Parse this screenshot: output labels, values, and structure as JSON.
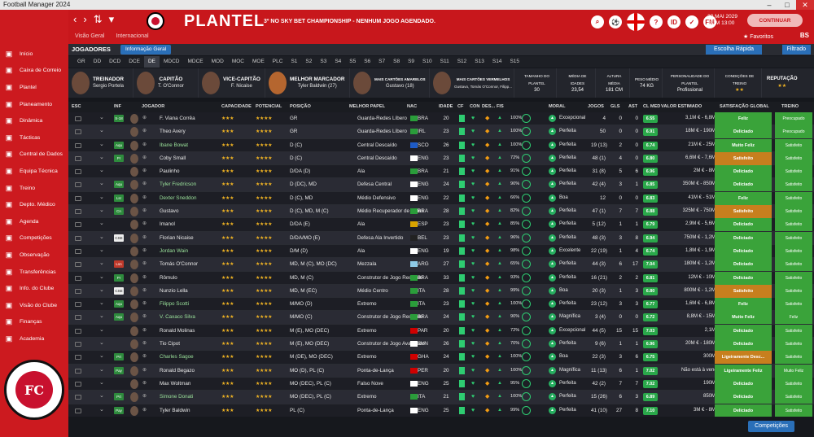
{
  "window": {
    "title": "Football Manager 2024"
  },
  "sidebar": {
    "items": [
      {
        "label": "Início",
        "icon": "home-icon"
      },
      {
        "label": "Caixa de Correio",
        "icon": "mail-icon"
      },
      {
        "label": "Plantel",
        "icon": "squad-icon"
      },
      {
        "label": "Planeamento",
        "icon": "planning-icon"
      },
      {
        "label": "Dinâmica",
        "icon": "dynamics-icon"
      },
      {
        "label": "Tácticas",
        "icon": "tactics-icon"
      },
      {
        "label": "Central de Dados",
        "icon": "data-icon"
      },
      {
        "label": "Equipa Técnica",
        "icon": "staff-icon"
      },
      {
        "label": "Treino",
        "icon": "training-icon"
      },
      {
        "label": "Depto. Médico",
        "icon": "medical-icon"
      },
      {
        "label": "Agenda",
        "icon": "calendar-icon"
      },
      {
        "label": "Competições",
        "icon": "trophy-icon"
      },
      {
        "label": "Observação",
        "icon": "scouting-icon"
      },
      {
        "label": "Transferências",
        "icon": "transfer-icon"
      },
      {
        "label": "Info. do Clube",
        "icon": "club-icon"
      },
      {
        "label": "Visão do Clube",
        "icon": "vision-icon"
      },
      {
        "label": "Finanças",
        "icon": "finance-icon"
      },
      {
        "label": "Academia",
        "icon": "academy-icon"
      }
    ],
    "crest_text": "FOOTBALL CLUB UNITED OF MANCHESTER",
    "crest_initials": "FC"
  },
  "header": {
    "title": "PLANTEL",
    "subtitle": "3º NO SKY BET CHAMPIONSHIP - NENHUM JOGO AGENDADO.",
    "subnav": [
      "Visão Geral",
      "Internacional"
    ],
    "date_line1": "30 MAI 2029",
    "date_line2": "DOM 13:00",
    "continue_label": "CONTINUAR",
    "favorites_label": "★ Favoritos",
    "bs_label": "BS",
    "nav_back": "‹",
    "nav_forward": "›"
  },
  "toolbar": {
    "section_label": "JOGADORES",
    "view_label": "Informação Geral",
    "quick_label": "Escolha Rápida",
    "filter_label": "Filtrado"
  },
  "tabs": [
    "GR",
    "DD",
    "DCD",
    "DCE",
    "DE",
    "MDCD",
    "MDCE",
    "MOD",
    "MOC",
    "MOE",
    "PLC",
    "S1",
    "S2",
    "S3",
    "S4",
    "S5",
    "S6",
    "S7",
    "S8",
    "S9",
    "S10",
    "S11",
    "S12",
    "S13",
    "S14",
    "S15"
  ],
  "staff": {
    "trainer": {
      "role": "TREINADOR",
      "name": "Sergio Portela"
    },
    "captain": {
      "role": "CAPITÃO",
      "name": "T. O'Connor"
    },
    "vice": {
      "role": "VICE-CAPITÃO",
      "name": "F. Nicaise"
    },
    "scorer": {
      "role": "MELHOR MARCADOR",
      "name": "Tyler Baldwin (27)"
    },
    "yellow": {
      "role": "MAIS CARTÕES AMARELOS",
      "name": "Gustavo (18)"
    },
    "red": {
      "role": "MAIS CARTÕES VERMELHOS",
      "name": "Gustavo, Tomás O'Connor, Filipp..."
    },
    "squad_size": {
      "label": "TAMANHO DO PLANTEL",
      "value": "30"
    },
    "avg_age": {
      "label": "MÉDIA DE IDADES",
      "value": "23,54"
    },
    "avg_height": {
      "label": "ALTURA MÉDIA",
      "value": "181 CM"
    },
    "avg_weight": {
      "label": "PESO MÉDIO",
      "value": "74 KG"
    },
    "personality": {
      "label": "PERSONALIDADE DO PLANTEL",
      "value": "Profissional"
    },
    "training": {
      "label": "CONDIÇÕES DE TREINO",
      "stars": "★★"
    },
    "reputation": {
      "label": "REPUTAÇÃO",
      "stars": "★★"
    }
  },
  "columns": {
    "esc": "ESC",
    "inf": "INF",
    "player": "JOGADOR",
    "capacity": "CAPACIDADE",
    "potential": "POTENCIAL",
    "position": "POSIÇÃO",
    "role": "MELHOR PAPEL",
    "nat": "NAC",
    "age": "IDADE",
    "cf": "CF",
    "con": "CON",
    "des": "DES...",
    "fis": "FIS",
    "morale": "MORAL",
    "games": "JOGOS",
    "goals": "GLS",
    "assists": "AST",
    "rating": "CL MED",
    "value": "VALOR ESTIMADO",
    "satisfaction": "SATISFAÇÃO GLOBAL",
    "training": "TREINO"
  },
  "players": [
    {
      "badge": "S-18",
      "name": "F. Viana Corrêa",
      "cap": "★★★",
      "pot": "★★★★",
      "pos": "GR",
      "role": "Guarda-Redes Líbero",
      "nat": "BRA",
      "age": "20",
      "pct": "100%",
      "moral": "Excepcional",
      "jog": "4",
      "gls": "0",
      "ast": "0",
      "cm": "6.55",
      "val": "3,1M € - 6,8M €",
      "sat": "Feliz",
      "tre": "Preocupado"
    },
    {
      "badge": "",
      "name": "Theo Avery",
      "cap": "★★★",
      "pot": "★★★★",
      "pos": "GR",
      "role": "Guarda-Redes Líbero",
      "nat": "IRL",
      "age": "23",
      "pct": "100%",
      "moral": "Perfeita",
      "jog": "50",
      "gls": "0",
      "ast": "0",
      "cm": "6.91",
      "val": "18M € - 190M €",
      "sat": "Deliciado",
      "tre": "Preocupado"
    },
    {
      "badge": "Aqu",
      "name": "Ibane Bowat",
      "cap": "★★★",
      "pot": "★★★★",
      "pos": "D (C)",
      "role": "Central Descaído",
      "nat": "SCO",
      "age": "26",
      "pct": "100%",
      "moral": "Perfeita",
      "jog": "19 (13)",
      "gls": "2",
      "ast": "0",
      "cm": "6.74",
      "val": "21M € - 25M €",
      "sat": "Muito Feliz",
      "tre": "Satisfeito"
    },
    {
      "badge": "Pr",
      "name": "Coby Small",
      "cap": "★★★",
      "pot": "★★★★",
      "pos": "D (C)",
      "role": "Central Descaído",
      "nat": "ENG",
      "age": "23",
      "pct": "72%",
      "moral": "Perfeita",
      "jog": "48 (1)",
      "gls": "4",
      "ast": "0",
      "cm": "6.80",
      "val": "6,6M € - 7,6M €",
      "sat": "Satisfeito",
      "tre": "Satisfeito"
    },
    {
      "badge": "",
      "name": "Paulinho",
      "cap": "★★★",
      "pot": "★★★★",
      "pos": "D/DA (D)",
      "role": "Ala",
      "nat": "BRA",
      "age": "21",
      "pct": "91%",
      "moral": "Perfeita",
      "jog": "31 (8)",
      "gls": "5",
      "ast": "6",
      "cm": "6.96",
      "val": "2M € - 8M €",
      "sat": "Deliciado",
      "tre": "Satisfeito"
    },
    {
      "badge": "Aqu",
      "name": "Tyler Fredricson",
      "cap": "★★★",
      "pot": "★★★★",
      "pos": "D (DC), MD",
      "role": "Defesa Central",
      "nat": "ENG",
      "age": "24",
      "pct": "90%",
      "moral": "Perfeita",
      "jog": "42 (4)",
      "gls": "3",
      "ast": "1",
      "cm": "6.85",
      "val": "350M € - 850M €",
      "sat": "Deliciado",
      "tre": "Satisfeito"
    },
    {
      "badge": "Lsr",
      "name": "Dexter Sneddon",
      "cap": "★★★",
      "pot": "★★★★",
      "pos": "D (C), MD",
      "role": "Médio Defensivo",
      "nat": "ENG",
      "age": "22",
      "pct": "66%",
      "moral": "Boa",
      "jog": "12",
      "gls": "0",
      "ast": "0",
      "cm": "6.83",
      "val": "41M € - 51M €",
      "sat": "Feliz",
      "tre": "Satisfeito"
    },
    {
      "badge": "Cn",
      "name": "Gustavo",
      "cap": "★★★",
      "pot": "★★★★",
      "pos": "D (C), MD, M (C)",
      "role": "Médio Recuperador de Bolas",
      "nat": "BRA",
      "age": "28",
      "pct": "82%",
      "moral": "Perfeita",
      "jog": "47 (1)",
      "gls": "7",
      "ast": "7",
      "cm": "6.88",
      "val": "325M € - 750M €",
      "sat": "Satisfeito",
      "tre": "Satisfeito"
    },
    {
      "badge": "",
      "name": "Imanol",
      "cap": "★★★",
      "pot": "★★★★",
      "pos": "D/DA (E)",
      "role": "Ala",
      "nat": "ESP",
      "age": "23",
      "pct": "85%",
      "moral": "Perfeita",
      "jog": "5 (12)",
      "gls": "1",
      "ast": "1",
      "cm": "6.79",
      "val": "2,9M € - 5,6M €",
      "sat": "Deliciado",
      "tre": "Satisfeito"
    },
    {
      "badge": "CSE",
      "name": "Florian Nicaise",
      "cap": "★★★",
      "pot": "★★★★",
      "pos": "D/DA/MO (E)",
      "role": "Defesa Ala Invertido",
      "nat": "BEL",
      "age": "23",
      "pct": "96%",
      "moral": "Perfeita",
      "jog": "48 (3)",
      "gls": "3",
      "ast": "8",
      "cm": "6.94",
      "val": "750M € - 1,2M €",
      "sat": "Deliciado",
      "tre": "Satisfeito"
    },
    {
      "badge": "",
      "name": "Jordan Wain",
      "cap": "★★★",
      "pot": "★★★★",
      "pos": "D/M (D)",
      "role": "Ala",
      "nat": "ENG",
      "age": "19",
      "pct": "98%",
      "moral": "Excelente",
      "jog": "22 (19)",
      "gls": "1",
      "ast": "4",
      "cm": "6.74",
      "val": "1,8M € - 1,9M €",
      "sat": "Deliciado",
      "tre": "Satisfeito"
    },
    {
      "badge": "Lsn",
      "name": "Tomás O'Connor",
      "cap": "★★★",
      "pot": "★★★★",
      "pos": "MD, M (C), MO (DC)",
      "role": "Mezzala",
      "nat": "ARG",
      "age": "27",
      "pct": "65%",
      "moral": "Perfeita",
      "jog": "44 (3)",
      "gls": "6",
      "ast": "17",
      "cm": "7.04",
      "val": "180M € - 1,2M €",
      "sat": "Deliciado",
      "tre": "Satisfeito"
    },
    {
      "badge": "Pr",
      "name": "Rômulo",
      "cap": "★★★",
      "pot": "★★★★",
      "pos": "MD, M (C)",
      "role": "Construtor de Jogo Recuado",
      "nat": "BRA",
      "age": "33",
      "pct": "93%",
      "moral": "Perfeita",
      "jog": "16 (21)",
      "gls": "2",
      "ast": "2",
      "cm": "6.81",
      "val": "12M € - 10M €",
      "sat": "Deliciado",
      "tre": "Satisfeito"
    },
    {
      "badge": "CSE",
      "name": "Nunzio Lella",
      "cap": "★★★",
      "pot": "★★★★",
      "pos": "MD, M (EC)",
      "role": "Médio Centro",
      "nat": "ITA",
      "age": "28",
      "pct": "99%",
      "moral": "Boa",
      "jog": "20 (3)",
      "gls": "1",
      "ast": "3",
      "cm": "6.80",
      "val": "800M € - 1,2M €",
      "sat": "Satisfeito",
      "tre": "Satisfeito"
    },
    {
      "badge": "Aqu",
      "name": "Filippo Scotti",
      "cap": "★★★",
      "pot": "★★★★",
      "pos": "M/MO (D)",
      "role": "Extremo",
      "nat": "ITA",
      "age": "23",
      "pct": "100%",
      "moral": "Perfeita",
      "jog": "23 (12)",
      "gls": "3",
      "ast": "3",
      "cm": "6.77",
      "val": "1,6M € - 6,8M €",
      "sat": "Feliz",
      "tre": "Satisfeito"
    },
    {
      "badge": "Aqu",
      "name": "V. Caxaco Silva",
      "cap": "★★★",
      "pot": "★★★★",
      "pos": "M/MO (C)",
      "role": "Construtor de Jogo Recuado",
      "nat": "BRA",
      "age": "24",
      "pct": "90%",
      "moral": "Magnífica",
      "jog": "3 (4)",
      "gls": "0",
      "ast": "0",
      "cm": "6.72",
      "val": "8,8M € - 15M €",
      "sat": "Muito Feliz",
      "tre": "Feliz"
    },
    {
      "badge": "",
      "name": "Ronald Molinas",
      "cap": "★★★",
      "pot": "★★★★",
      "pos": "M (E), MO (DEC)",
      "role": "Extremo",
      "nat": "PAR",
      "age": "20",
      "pct": "72%",
      "moral": "Excepcional",
      "jog": "44 (5)",
      "gls": "15",
      "ast": "15",
      "cm": "7.03",
      "val": "2,1M €",
      "sat": "Deliciado",
      "tre": "Satisfeito"
    },
    {
      "badge": "",
      "name": "Tio Cipot",
      "cap": "★★★",
      "pot": "★★★★",
      "pos": "M (E), MO (DEC)",
      "role": "Construtor de Jogo Avançado",
      "nat": "SVN",
      "age": "26",
      "pct": "70%",
      "moral": "Perfeita",
      "jog": "9 (6)",
      "gls": "1",
      "ast": "1",
      "cm": "6.96",
      "val": "20M € - 180M €",
      "sat": "Deliciado",
      "tre": "Satisfeito"
    },
    {
      "badge": "Prt",
      "name": "Charles Sagoe",
      "cap": "★★★",
      "pot": "★★★★",
      "pos": "M (DE), MO (DEC)",
      "role": "Extremo",
      "nat": "GHA",
      "age": "24",
      "pct": "100%",
      "moral": "Boa",
      "jog": "22 (3)",
      "gls": "3",
      "ast": "6",
      "cm": "6.75",
      "val": "300M €",
      "sat": "Ligeiramente Desc...",
      "tre": "Satisfeito"
    },
    {
      "badge": "Pay",
      "name": "Ronald Begazo",
      "cap": "★★★",
      "pot": "★★★★",
      "pos": "MO (D), PL (C)",
      "role": "Ponta-de-Lança",
      "nat": "PER",
      "age": "20",
      "pct": "100%",
      "moral": "Magnífica",
      "jog": "11 (13)",
      "gls": "6",
      "ast": "1",
      "cm": "7.02",
      "val": "Não está à venda",
      "sat": "Ligeiramente Feliz",
      "tre": "Muito Feliz"
    },
    {
      "badge": "",
      "name": "Max Woltman",
      "cap": "★★★",
      "pot": "★★★★",
      "pos": "MO (DEC), PL (C)",
      "role": "Falso Nove",
      "nat": "ENG",
      "age": "25",
      "pct": "95%",
      "moral": "Perfeita",
      "jog": "42 (2)",
      "gls": "7",
      "ast": "7",
      "cm": "7.02",
      "val": "190M €",
      "sat": "Deliciado",
      "tre": "Satisfeito"
    },
    {
      "badge": "Prt",
      "name": "Simone Donati",
      "cap": "★★★",
      "pot": "★★★★",
      "pos": "MO (DEC), PL (C)",
      "role": "Extremo",
      "nat": "ITA",
      "age": "21",
      "pct": "100%",
      "moral": "Perfeita",
      "jog": "15 (26)",
      "gls": "6",
      "ast": "3",
      "cm": "6.89",
      "val": "850M €",
      "sat": "Deliciado",
      "tre": "Satisfeito"
    },
    {
      "badge": "Pay",
      "name": "Tyler Baldwin",
      "cap": "★★★",
      "pot": "★★★★",
      "pos": "PL (C)",
      "role": "Ponta-de-Lança",
      "nat": "ENG",
      "age": "25",
      "pct": "99%",
      "moral": "Perfeita",
      "jog": "41 (10)",
      "gls": "27",
      "ast": "8",
      "cm": "7.10",
      "val": "3M € - 8M €",
      "sat": "Deliciado",
      "tre": "Satisfeito"
    }
  ],
  "badge_colors": {
    "Aqu": "#2e8b3d",
    "Pr": "#2e8b3d",
    "Lsr": "#2e8b3d",
    "Cn": "#2e8b3d",
    "CSE": "#eeeeee",
    "Lsn": "#c0392b",
    "Prt": "#2e8b3d",
    "Pay": "#2e8b3d",
    "S-18": "#2e8b3d"
  },
  "sat_colors": {
    "Feliz": "#3aa33a",
    "Deliciado": "#3aa33a",
    "Muito Feliz": "#3aa33a",
    "Satisfeito": "#c77f1e",
    "Ligeiramente Desc...": "#c77f1e",
    "Ligeiramente Feliz": "#3aa33a"
  },
  "bottom": {
    "competitions_label": "Competições"
  }
}
